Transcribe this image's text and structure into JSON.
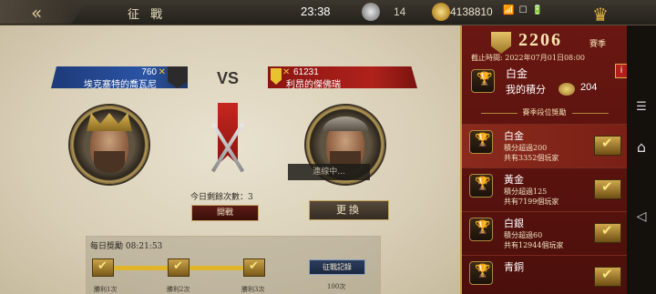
{
  "topbar": {
    "back_glyph": "«",
    "title": "征 戰",
    "time": "23:38",
    "silver_count": "14",
    "gold_count": "4138810",
    "status_icons": "📶 ☐ 🔋",
    "crown_glyph": "♛"
  },
  "battle": {
    "left_player": {
      "points": "760",
      "name": "埃克塞特的喬瓦尼"
    },
    "right_player": {
      "points": "61231",
      "name": "利昂的傑佛瑞"
    },
    "vs": "VS",
    "connecting": "連線中...",
    "remaining_label": "今日剩餘次數：3",
    "start_button": "開戰",
    "change_button": "更換"
  },
  "daily_reward": {
    "label": "每日獎勵 08:21:53",
    "chests": [
      "勝利1次",
      "勝利2次",
      "勝利3次"
    ],
    "record_button": "征戰記錄",
    "match_count": "100次"
  },
  "season": {
    "number": "2206",
    "suffix": "賽季",
    "deadline": "截止時間: 2022年07月01日08:00",
    "my_rank": "白金",
    "my_points_label": "我的積分",
    "my_points": "204",
    "section_title": "賽季段位獎勵",
    "tiers": [
      {
        "name": "白金",
        "req": "積分超過200",
        "players": "共有3352個玩家",
        "cup": "🏆"
      },
      {
        "name": "黃金",
        "req": "積分超過125",
        "players": "共有7199個玩家",
        "cup": "🏆"
      },
      {
        "name": "白銀",
        "req": "積分超過60",
        "players": "共有12944個玩家",
        "cup": "🏆"
      },
      {
        "name": "青銅",
        "req": "",
        "players": "",
        "cup": "🏆"
      }
    ],
    "info_glyph": "i"
  },
  "sysnav": {
    "recent": "☰",
    "home": "⌂",
    "back": "◁"
  }
}
